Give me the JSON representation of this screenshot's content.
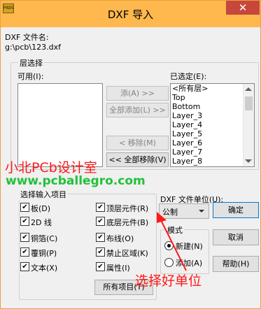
{
  "window": {
    "title": "DXF 导入",
    "close_glyph": "✕",
    "app_icon_text": "PADS"
  },
  "file": {
    "label": "DXF 文件名:",
    "path": "g:\\pcb\\123.dxf"
  },
  "layer_select": {
    "title": "层选择",
    "available_label": "可用(I):",
    "selected_label": "已选定(E):",
    "available_items": [],
    "selected_items": [
      "<所有层>",
      "Top",
      "Bottom",
      "Layer_3",
      "Layer_4",
      "Layer_5",
      "Layer_6",
      "Layer_7",
      "Layer_8"
    ],
    "buttons": {
      "add": "添(A) >>",
      "add_all": "全部添加(L) >>",
      "remove": "< 移除(M)",
      "remove_all": "<< 全部移除(V)"
    }
  },
  "import_items": {
    "title": "选择输入项目",
    "checkboxes": [
      {
        "label": "板(D)",
        "checked": true
      },
      {
        "label": "顶层元件(R)",
        "checked": true
      },
      {
        "label": "2D 线",
        "checked": true
      },
      {
        "label": "底层元件(B)",
        "checked": true
      },
      {
        "label": "铜箔(C)",
        "checked": true
      },
      {
        "label": "布线(O)",
        "checked": true
      },
      {
        "label": "覆铜(P)",
        "checked": true
      },
      {
        "label": "禁止区域(K)",
        "checked": true
      },
      {
        "label": "文本(X)",
        "checked": true
      },
      {
        "label": "属性(I)",
        "checked": true
      }
    ],
    "all_button": "所有项目(T)"
  },
  "units": {
    "label": "DXF 文件单位(U):",
    "value": "公制"
  },
  "mode": {
    "title": "模式",
    "new_label": "新建(N)",
    "add_label": "添加(A)",
    "selected": "new"
  },
  "actions": {
    "ok": "确定",
    "cancel": "取消",
    "help": "帮助(H)"
  },
  "overlay": {
    "brand": "小北PCb设计室",
    "url": "www.pcballegro.com",
    "hint": "选择好单位",
    "hint_color": "#ff1a1a",
    "brand_color": "#ff1a1a",
    "url_color": "#22c03a"
  }
}
